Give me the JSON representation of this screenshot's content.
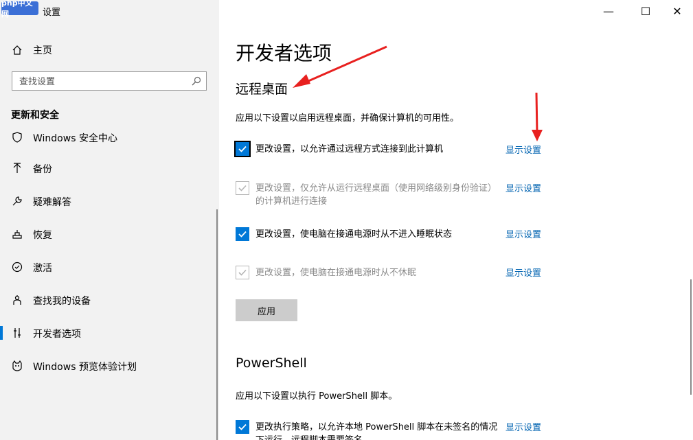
{
  "watermark": "php中文网",
  "app_title": "设置",
  "window_controls": {
    "minimize": "—",
    "maximize": "☐",
    "close": "✕"
  },
  "sidebar": {
    "home_label": "主页",
    "search_placeholder": "查找设置",
    "section_heading": "更新和安全",
    "items": [
      {
        "label": "Windows 安全中心",
        "icon": "shield-icon"
      },
      {
        "label": "备份",
        "icon": "backup-arrow-icon"
      },
      {
        "label": "疑难解答",
        "icon": "wrench-icon"
      },
      {
        "label": "恢复",
        "icon": "recovery-icon"
      },
      {
        "label": "激活",
        "icon": "check-circle-icon"
      },
      {
        "label": "查找我的设备",
        "icon": "person-location-icon"
      },
      {
        "label": "开发者选项",
        "icon": "developer-sliders-icon",
        "active": true
      },
      {
        "label": "Windows 预览体验计划",
        "icon": "insider-cat-icon"
      }
    ]
  },
  "main": {
    "title": "开发者选项",
    "remote_desktop": {
      "heading": "远程桌面",
      "description": "应用以下设置以启用远程桌面，并确保计算机的可用性。",
      "options": [
        {
          "label": "更改设置，以允许通过远程方式连接到此计算机",
          "checked": true,
          "enabled": true,
          "link": "显示设置"
        },
        {
          "label": "更改设置，仅允许从运行远程桌面（使用网络级别身份验证）的计算机进行连接",
          "checked": true,
          "enabled": false,
          "link": "显示设置"
        },
        {
          "label": "更改设置，使电脑在接通电源时从不进入睡眠状态",
          "checked": true,
          "enabled": true,
          "link": "显示设置"
        },
        {
          "label": "更改设置，使电脑在接通电源时从不休眠",
          "checked": true,
          "enabled": false,
          "link": "显示设置"
        }
      ],
      "apply_label": "应用"
    },
    "powershell": {
      "heading": "PowerShell",
      "description": "应用以下设置以执行 PowerShell 脚本。",
      "options": [
        {
          "label": "更改执行策略，以允许本地 PowerShell 脚本在未签名的情况下运行。远程脚本需要签名。",
          "checked": true,
          "enabled": true,
          "link": "显示设置"
        }
      ]
    }
  },
  "colors": {
    "accent": "#0078d7",
    "link": "#0063b1",
    "sidebar_bg": "#f2f2f2",
    "annotation_arrow": "#e8201f"
  }
}
